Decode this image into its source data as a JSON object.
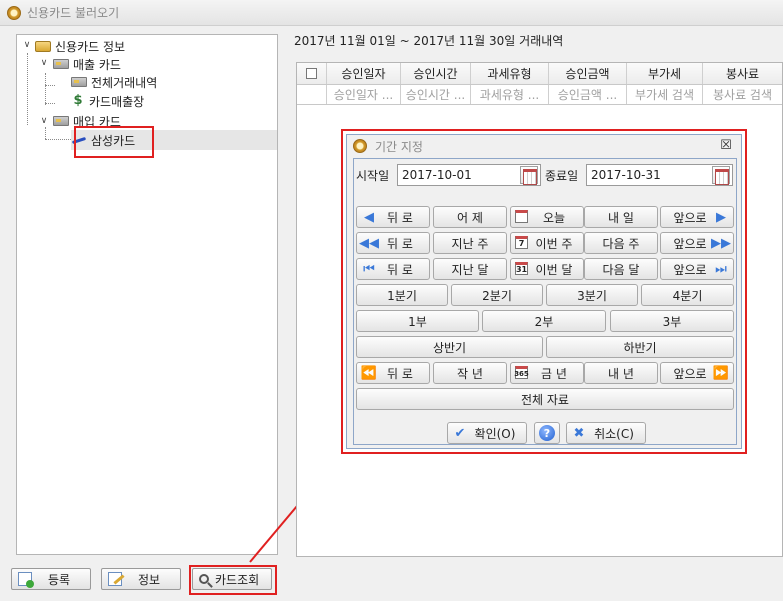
{
  "window": {
    "title": "신용카드 불러오기"
  },
  "tree": {
    "root": {
      "label": "신용카드 정보",
      "icon": "home-search-icon"
    },
    "sales": {
      "label": "매출 카드",
      "icon": "card-folder-icon"
    },
    "sales_all": {
      "label": "전체거래내역",
      "icon": "card-icon"
    },
    "sales_ledger": {
      "label": "카드매출장",
      "icon": "dollar-icon"
    },
    "purchase": {
      "label": "매입 카드",
      "icon": "card-folder-icon"
    },
    "samsung": {
      "label": "삼성카드",
      "icon": "card-pen-icon"
    }
  },
  "bottom_buttons": {
    "register": "등록",
    "info": "정보",
    "card_query": "카드조회"
  },
  "range_text": "2017년 11월 01일 ~ 2017년 11월 30일 거래내역",
  "grid": {
    "columns": [
      "승인일자",
      "승인시간",
      "과세유형",
      "승인금액",
      "부가세",
      "봉사료"
    ],
    "filters": [
      "승인일자 ...",
      "승인시간 ...",
      "과세유형 ...",
      "승인금액 ...",
      "부가세 검색",
      "봉사료 검색"
    ]
  },
  "dialog": {
    "title": "기간 지정",
    "start_label": "시작일",
    "start_value": "2017-10-01",
    "end_label": "종료일",
    "end_value": "2017-10-31",
    "row_day": [
      "뒤 로",
      "어 제",
      "오늘",
      "내 일",
      "앞으로"
    ],
    "row_week": [
      "뒤 로",
      "지난 주",
      "이번 주",
      "다음 주",
      "앞으로"
    ],
    "row_month": [
      "뒤 로",
      "지난 달",
      "이번 달",
      "다음 달",
      "앞으로"
    ],
    "quarters": [
      "1분기",
      "2분기",
      "3분기",
      "4분기"
    ],
    "periods": [
      "1부",
      "2부",
      "3부"
    ],
    "halves": [
      "상반기",
      "하반기"
    ],
    "row_year": [
      "뒤 로",
      "작 년",
      "금 년",
      "내 년",
      "앞으로"
    ],
    "all_data": "전체 자료",
    "confirm": "확인(O)",
    "help": "?",
    "cancel": "취소(C)",
    "cal_icons": {
      "week": "7",
      "month": "31",
      "year": "365"
    }
  },
  "colors": {
    "highlight": "#e02020",
    "accent_blue": "#3a78d8"
  }
}
